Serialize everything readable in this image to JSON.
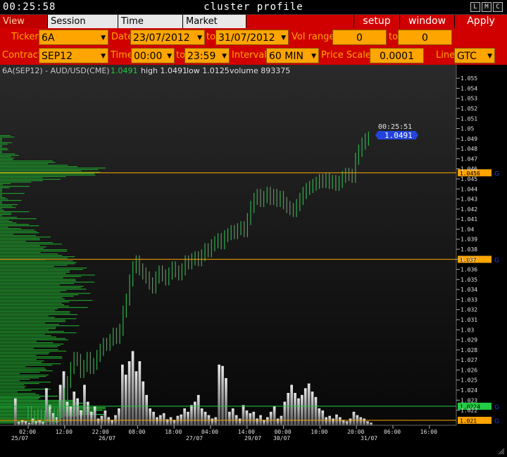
{
  "titlebar": {
    "clock": "00:25:58",
    "title": "cluster profile",
    "buttons": [
      "L",
      "M",
      "C"
    ]
  },
  "menubar": {
    "tabs": [
      {
        "label": "View DOM"
      },
      {
        "label": "Session Hours"
      },
      {
        "label": "Time Interval"
      },
      {
        "label": "Market Watch"
      }
    ],
    "right": [
      {
        "label": "setup"
      },
      {
        "label": "window"
      },
      {
        "label": "Apply"
      }
    ]
  },
  "row1": {
    "ticker_label": "Ticker",
    "ticker": "6A",
    "date_label": "Date",
    "date_from": "23/07/2012",
    "to_label": "to",
    "date_to": "31/07/2012",
    "vol_label": "Vol range",
    "vol_from": "0",
    "vol_to_label": "to",
    "vol_to": "0"
  },
  "row2": {
    "contract_label": "Contract",
    "contract": "SEP12",
    "time_label": "Time",
    "time_from": "00:00",
    "to_label": "to",
    "time_to": "23:59",
    "interval_label": "Interval",
    "interval": "60 MIN",
    "scale_label": "Price Scale",
    "scale": "0.0001",
    "line_label": "Line",
    "line": "GTC"
  },
  "chart_header": {
    "symbol": "6A(SEP12) - AUD/USD(CME)",
    "last": "1.0491",
    "high_text": "high 1.0491",
    "low_text": "low 1.0125",
    "volume_text": "volume 893375"
  },
  "current": {
    "time": "00:25:51",
    "price": "1.0491"
  },
  "colors": {
    "accent": "#ffa500",
    "menu": "#d00000",
    "up": "#22cc44",
    "current": "#2244dd"
  },
  "chart_data": {
    "type": "candlestick",
    "price_ticks": [
      "1.055",
      "1.054",
      "1.053",
      "1.052",
      "1.051",
      "1.05",
      "1.049",
      "1.048",
      "1.047",
      "1.046",
      "1.045",
      "1.044",
      "1.043",
      "1.042",
      "1.041",
      "1.04",
      "1.039",
      "1.038",
      "1.037",
      "1.036",
      "1.035",
      "1.034",
      "1.033",
      "1.032",
      "1.031",
      "1.03",
      "1.029",
      "1.028",
      "1.027",
      "1.026",
      "1.025",
      "1.024",
      "1.023",
      "1.022"
    ],
    "ylim": [
      1.0205,
      1.0555
    ],
    "time_labels": [
      "02:00",
      "12:00",
      "22:00",
      "08:00",
      "18:00",
      "04:00",
      "14:00",
      "00:00",
      "10:00",
      "20:00",
      "06:00",
      "16:00"
    ],
    "date_labels": [
      "25/07",
      "26/07",
      "27/07",
      "29/07",
      "30/07",
      "31/07"
    ],
    "levels": [
      {
        "label": "1.0456",
        "value": 1.0456,
        "color": "#ffa500"
      },
      {
        "label": "1.037",
        "value": 1.037,
        "color": "#ffa500"
      },
      {
        "label": "1.0224",
        "value": 1.0224,
        "color": "#22cc44"
      },
      {
        "label": "1.021",
        "value": 1.021,
        "color": "#ffa500"
      }
    ],
    "line_tag": "G",
    "closes": [
      1.0218,
      1.0212,
      1.0214,
      1.0215,
      1.0213,
      1.0214,
      1.0215,
      1.0212,
      1.0216,
      1.0215,
      1.0224,
      1.0236,
      1.0248,
      1.0262,
      1.0272,
      1.027,
      1.0258,
      1.0264,
      1.0272,
      1.0262,
      1.0266,
      1.0274,
      1.028,
      1.0286,
      1.0285,
      1.029,
      1.0296,
      1.0292,
      1.03,
      1.0318,
      1.033,
      1.0349,
      1.0362,
      1.0368,
      1.036,
      1.0356,
      1.0352,
      1.0346,
      1.0342,
      1.0352,
      1.0358,
      1.0354,
      1.035,
      1.0356,
      1.0362,
      1.0358,
      1.0355,
      1.036,
      1.0368,
      1.0366,
      1.037,
      1.0372,
      1.0369,
      1.0374,
      1.038,
      1.0378,
      1.0384,
      1.0387,
      1.039,
      1.0386,
      1.0393,
      1.0395,
      1.0398,
      1.0396,
      1.04,
      1.0402,
      1.0398,
      1.041,
      1.0422,
      1.043,
      1.0434,
      1.0428,
      1.0432,
      1.0436,
      1.043,
      1.0434,
      1.0428,
      1.0432,
      1.0426,
      1.0422,
      1.042,
      1.0418,
      1.0424,
      1.043,
      1.0436,
      1.044,
      1.0442,
      1.0444,
      1.0446,
      1.0449,
      1.0447,
      1.045,
      1.0446,
      1.0448,
      1.0444,
      1.0447,
      1.0452,
      1.0455,
      1.0454,
      1.0452,
      1.047,
      1.0478,
      1.0485,
      1.0489,
      1.0491
    ],
    "volumes": [
      40,
      5,
      8,
      6,
      4,
      10,
      6,
      8,
      5,
      55,
      30,
      18,
      12,
      60,
      80,
      35,
      28,
      50,
      40,
      22,
      60,
      35,
      20,
      28,
      10,
      14,
      22,
      12,
      8,
      15,
      25,
      90,
      75,
      95,
      110,
      80,
      95,
      65,
      45,
      25,
      20,
      12,
      15,
      18,
      9,
      12,
      8,
      14,
      16,
      25,
      20,
      30,
      35,
      45,
      25,
      20,
      15,
      10,
      12,
      90,
      88,
      70,
      20,
      25,
      15,
      10,
      30,
      22,
      18,
      20,
      10,
      15,
      8,
      12,
      20,
      28,
      10,
      14,
      35,
      48,
      60,
      48,
      40,
      45,
      55,
      62,
      50,
      42,
      25,
      22,
      12,
      14,
      10,
      16,
      12,
      8,
      6,
      10,
      20,
      15,
      12,
      10,
      6,
      4
    ]
  }
}
